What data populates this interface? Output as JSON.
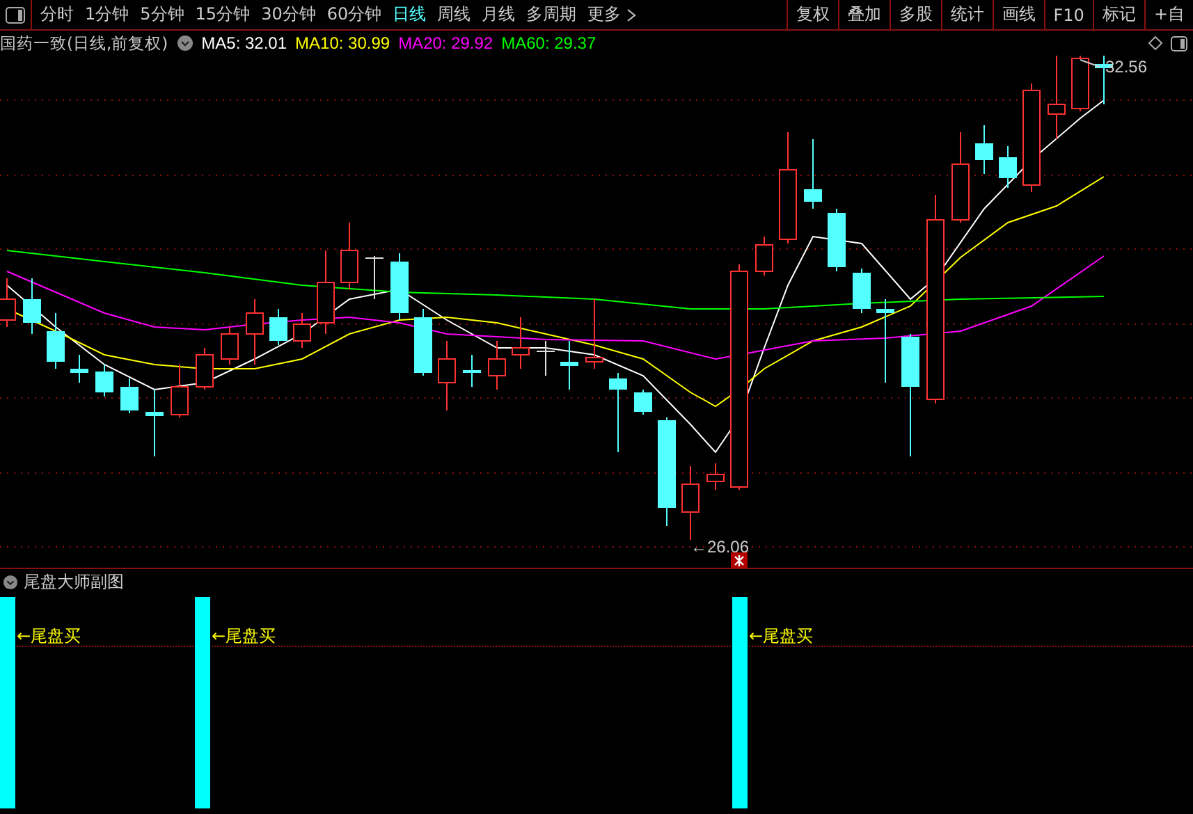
{
  "toolbar": {
    "periods": [
      {
        "label": "分时",
        "selected": false
      },
      {
        "label": "1分钟",
        "selected": false
      },
      {
        "label": "5分钟",
        "selected": false
      },
      {
        "label": "15分钟",
        "selected": false
      },
      {
        "label": "30分钟",
        "selected": false
      },
      {
        "label": "60分钟",
        "selected": false
      },
      {
        "label": "日线",
        "selected": true
      },
      {
        "label": "周线",
        "selected": false
      },
      {
        "label": "月线",
        "selected": false
      },
      {
        "label": "多周期",
        "selected": false
      },
      {
        "label": "更多",
        "selected": false
      }
    ],
    "buttons": [
      "复权",
      "叠加",
      "多股",
      "统计",
      "画线",
      "F10",
      "标记",
      "+自"
    ]
  },
  "chart_header": {
    "title": "国药一致(日线,前复权)",
    "indicators": [
      {
        "label": "MA5: 32.01",
        "color": "#ffffff"
      },
      {
        "label": "MA10: 30.99",
        "color": "#ffff00"
      },
      {
        "label": "MA20: 29.92",
        "color": "#ff00ff"
      },
      {
        "label": "MA60: 29.37",
        "color": "#00ff00"
      }
    ]
  },
  "price_labels": {
    "high": "32.56",
    "low": "←26.06"
  },
  "sub_panel": {
    "title": "尾盘大师副图",
    "signals": [
      "←尾盘买",
      "←尾盘买",
      "←尾盘买"
    ]
  }
}
